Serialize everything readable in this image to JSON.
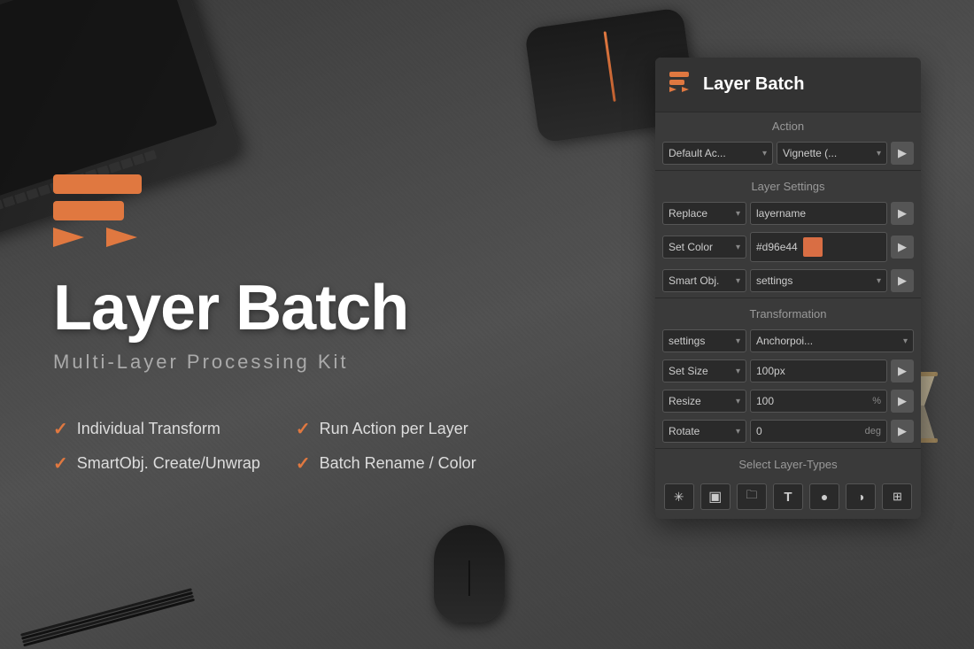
{
  "app": {
    "title": "Layer Batch",
    "subtitle": "Multi-Layer Processing Kit",
    "icon_label": "layer-batch-icon"
  },
  "features": [
    {
      "label": "Individual Transform",
      "col": 0
    },
    {
      "label": "Run Action per Layer",
      "col": 1
    },
    {
      "label": "SmartObj. Create/Unwrap",
      "col": 0
    },
    {
      "label": "Batch Rename / Color",
      "col": 1
    }
  ],
  "panel": {
    "title": "Layer Batch",
    "sections": {
      "action": {
        "label": "Action",
        "dropdown1": {
          "value": "Default Ac...",
          "options": [
            "Default Ac..."
          ]
        },
        "dropdown2": {
          "value": "Vignette (...",
          "options": [
            "Vignette (..."
          ]
        },
        "run_btn": "▶"
      },
      "layer_settings": {
        "label": "Layer Settings",
        "rows": [
          {
            "dropdown": {
              "value": "Replace",
              "options": [
                "Replace"
              ]
            },
            "input": "layername",
            "has_run": true
          },
          {
            "dropdown": {
              "value": "Set Color",
              "options": [
                "Set Color"
              ]
            },
            "input": "#d96e44",
            "has_color": true,
            "has_run": true
          },
          {
            "dropdown": {
              "value": "Smart Obj.",
              "options": [
                "Smart Obj."
              ]
            },
            "dropdown2": {
              "value": "settings",
              "options": [
                "settings"
              ]
            },
            "has_run": true
          }
        ]
      },
      "transformation": {
        "label": "Transformation",
        "rows": [
          {
            "dropdown": {
              "value": "settings",
              "options": [
                "settings"
              ]
            },
            "dropdown2": {
              "value": "Anchorpoi...",
              "options": [
                "Anchorpoi..."
              ]
            }
          },
          {
            "dropdown": {
              "value": "Set Size",
              "options": [
                "Set Size"
              ]
            },
            "input": "100px",
            "has_run": true
          },
          {
            "dropdown": {
              "value": "Resize",
              "options": [
                "Resize"
              ]
            },
            "input": "100",
            "unit": "%",
            "has_run": true
          },
          {
            "dropdown": {
              "value": "Rotate",
              "options": [
                "Rotate"
              ]
            },
            "input": "0",
            "unit": "deg",
            "has_run": true
          }
        ]
      },
      "select_layer_types": {
        "label": "Select Layer-Types",
        "buttons": [
          {
            "icon": "✳",
            "name": "all-layers-btn"
          },
          {
            "icon": "▣",
            "name": "group-layers-btn"
          },
          {
            "icon": "📁",
            "name": "folder-btn"
          },
          {
            "icon": "T",
            "name": "text-layers-btn"
          },
          {
            "icon": "●",
            "name": "shape-layers-btn"
          },
          {
            "icon": "◑",
            "name": "adjustment-layers-btn"
          },
          {
            "icon": "⊞",
            "name": "smart-obj-btn"
          }
        ]
      }
    }
  },
  "colors": {
    "orange": "#e07840",
    "panel_bg": "#3a3a3a",
    "panel_header": "#333333",
    "input_bg": "#2a2a2a",
    "section_label_color": "#999999",
    "text_color": "#cccccc"
  }
}
